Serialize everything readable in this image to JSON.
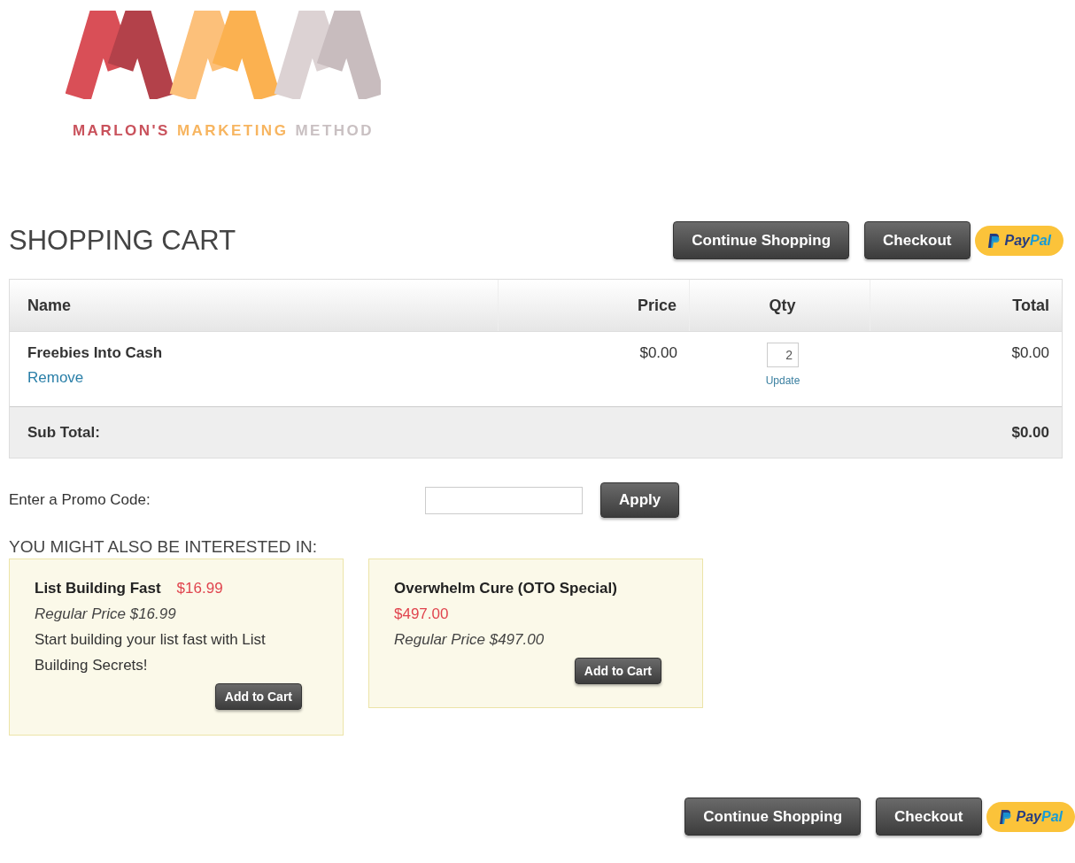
{
  "logo": {
    "words": [
      {
        "text": "MARLON'S",
        "color": "#c9525c"
      },
      {
        "text": "MARKETING",
        "color": "#f7b560"
      },
      {
        "text": "METHOD",
        "color": "#c9c0c2"
      }
    ]
  },
  "header": {
    "title": "SHOPPING CART",
    "continue": "Continue Shopping",
    "checkout": "Checkout",
    "paypal": {
      "pay": "Pay",
      "pal": "Pal"
    }
  },
  "table": {
    "columns": [
      "Name",
      "Price",
      "Qty",
      "Total"
    ],
    "rows": [
      {
        "name": "Freebies Into Cash",
        "remove": "Remove",
        "price": "$0.00",
        "qty": "2",
        "update": "Update",
        "total": "$0.00"
      }
    ],
    "subtotal": {
      "label": "Sub Total:",
      "value": "$0.00"
    }
  },
  "promo": {
    "label": "Enter a Promo Code:",
    "button": "Apply"
  },
  "suggestions": {
    "title": "YOU MIGHT ALSO BE INTERESTED IN:",
    "items": [
      {
        "name": "List Building Fast",
        "price": "$16.99",
        "price_inline": true,
        "regular": "Regular Price $16.99",
        "description": "Start building your list fast with List Building Secrets!",
        "button": "Add to Cart"
      },
      {
        "name": "Overwhelm Cure (OTO Special)",
        "price": "$497.00",
        "price_inline": false,
        "regular": "Regular Price $497.00",
        "button": "Add to Cart"
      }
    ]
  },
  "footer": {
    "continue": "Continue Shopping",
    "checkout": "Checkout",
    "paypal": {
      "pay": "Pay",
      "pal": "Pal"
    }
  }
}
